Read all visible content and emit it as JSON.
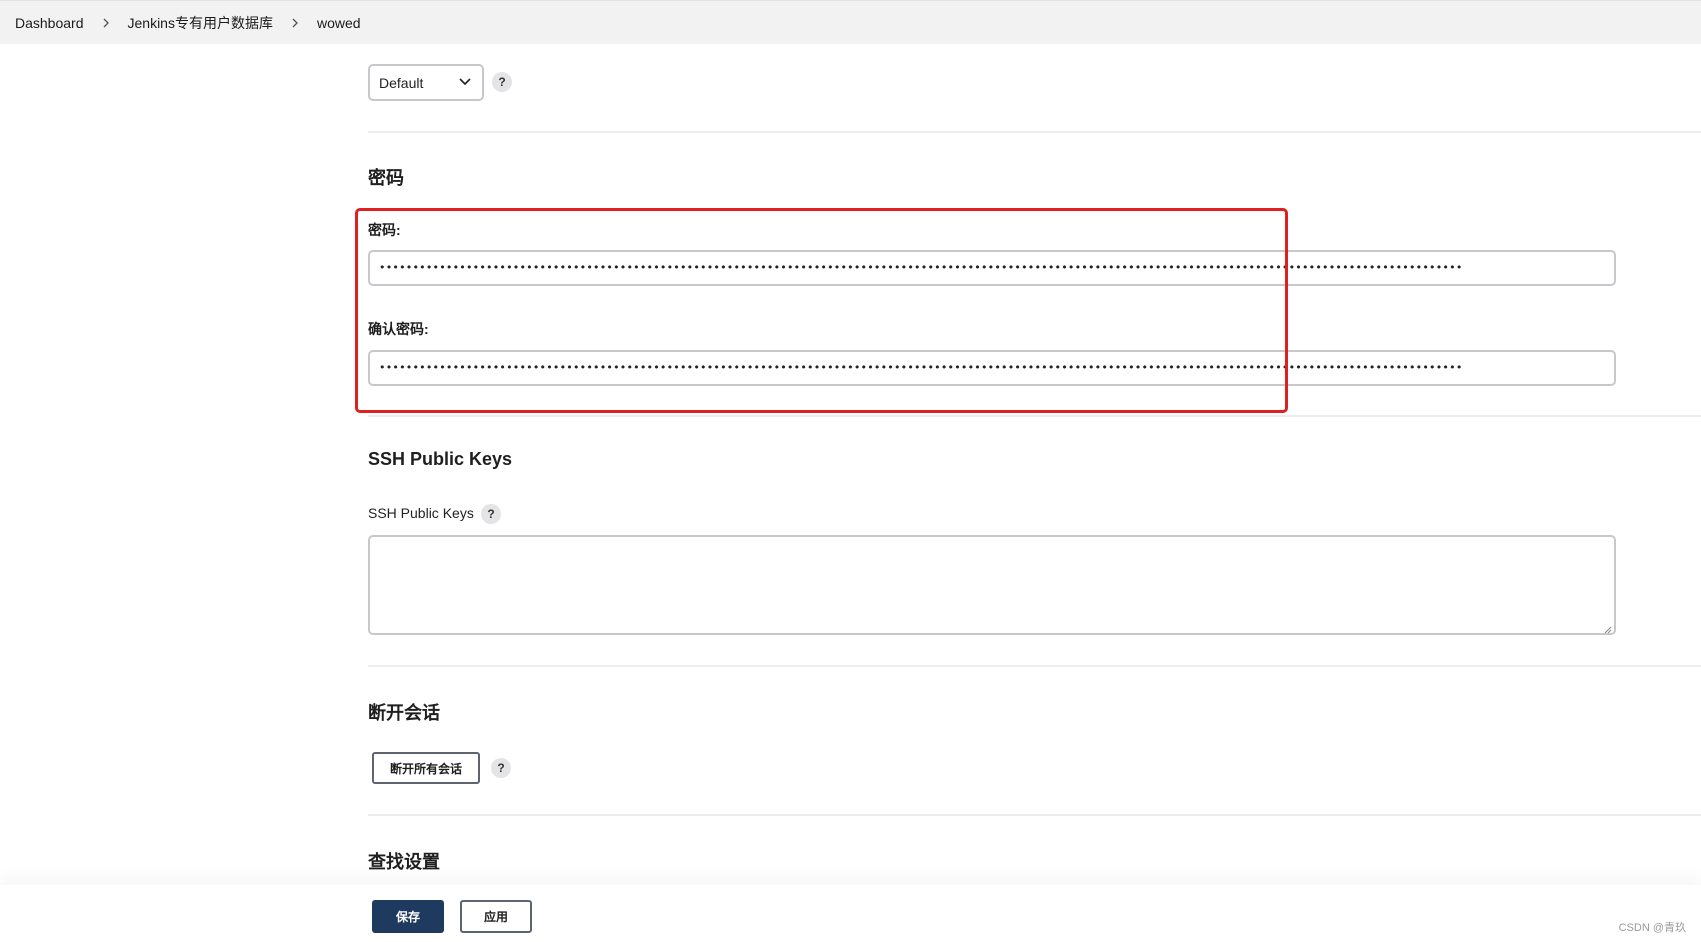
{
  "breadcrumb": {
    "items": [
      "Dashboard",
      "Jenkins专有用户数据库",
      "wowed"
    ]
  },
  "theme_select": {
    "value": "Default"
  },
  "help_label": "?",
  "password_section": {
    "title": "密码",
    "password_label": "密码:",
    "password_value": "••••••••••••••••••••••••••••••••••••••••••••••••••••••••••••••••••••••••••••••••••••••••••••••••••••••••••••••••••••••••••••••••••••••••••••••••••••••••••••••••••",
    "confirm_label": "确认密码:",
    "confirm_value": "••••••••••••••••••••••••••••••••••••••••••••••••••••••••••••••••••••••••••••••••••••••••••••••••••••••••••••••••••••••••••••••••••••••••••••••••••••••••••••••••••"
  },
  "ssh_section": {
    "title": "SSH Public Keys",
    "field_label": "SSH Public Keys"
  },
  "session_section": {
    "title": "断开会话",
    "button_label": "断开所有会话"
  },
  "search_section": {
    "title": "查找设置"
  },
  "footer": {
    "save_label": "保存",
    "apply_label": "应用"
  },
  "watermark": "CSDN @青玖",
  "colors": {
    "highlight": "#e02020",
    "primary_button": "#1f3a5f"
  }
}
